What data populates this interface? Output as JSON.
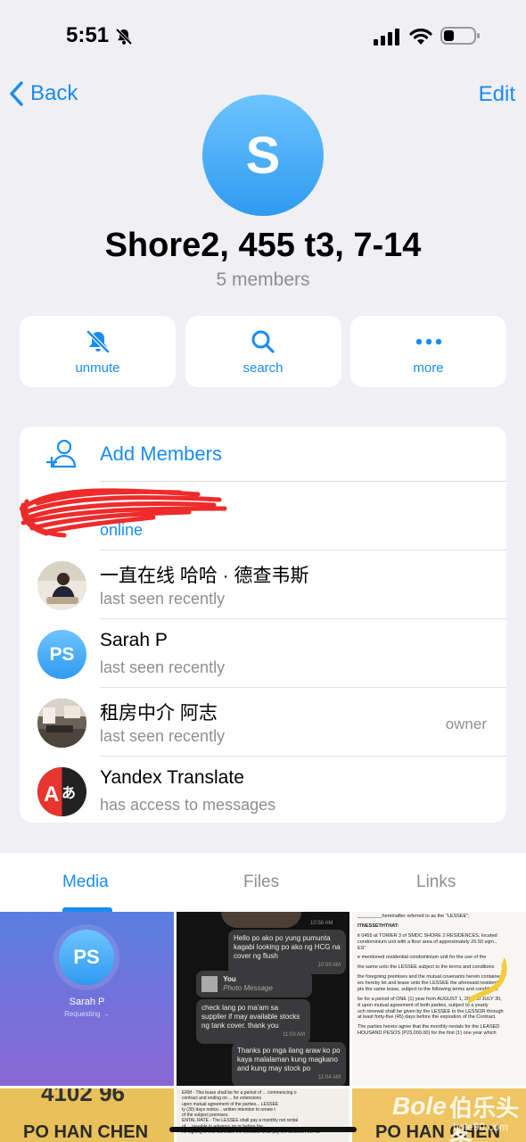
{
  "status_bar": {
    "time": "5:51"
  },
  "nav": {
    "back_label": "Back",
    "edit_label": "Edit"
  },
  "group": {
    "avatar_letter": "S",
    "title": "Shore2, 455 t3, 7-14",
    "subtitle": "5 members"
  },
  "actions": [
    {
      "label": "unmute",
      "icon": "bell-slash-icon"
    },
    {
      "label": "search",
      "icon": "magnifier-icon"
    },
    {
      "label": "more",
      "icon": "ellipsis-icon"
    }
  ],
  "members": {
    "add_label": "Add Members",
    "list": [
      {
        "name": "",
        "status": "online",
        "role": "",
        "avatar": "redacted"
      },
      {
        "name": "一直在线 哈哈 · 德查韦斯",
        "status": "last seen recently",
        "role": "",
        "avatar": "photo-person"
      },
      {
        "name": "Sarah P",
        "status": "last seen recently",
        "role": "",
        "avatar_initials": "PS"
      },
      {
        "name": "租房中介 阿志",
        "status": "last seen recently",
        "role": "owner",
        "avatar": "photo-room"
      },
      {
        "name": "Yandex Translate",
        "status": "has access to messages",
        "role": "",
        "avatar": "yandex-translate-icon"
      }
    ]
  },
  "tabs": [
    {
      "label": "Media",
      "active": true
    },
    {
      "label": "Files",
      "active": false
    },
    {
      "label": "Links",
      "active": false
    }
  ],
  "media": {
    "contact_card": {
      "initials": "PS",
      "name": "Sarah P",
      "subtitle": "Requesting →"
    },
    "chat": {
      "top_time": "10:58 AM",
      "messages": [
        {
          "text": "Hello po ako po yung pumunta kagabi looking po ako ng HCG na cover ng flush",
          "time": "10:59 AM"
        },
        {
          "sender": "You",
          "subtitle": "Photo Message"
        },
        {
          "text": "check lang po ma'am sa supplier if may available stocks ng tank cover. thank you",
          "time": "11:03 AM"
        },
        {
          "text": "Thanks po mga ilang araw ko po kaya malalaman kung magkano and kung may stock po",
          "time": "11:04 AM"
        }
      ]
    },
    "document": {
      "lines": [
        "_________hereinafter referred to as the \"LESSEE\";",
        "ITNESSETHTHAT:",
        "it 0455 at TOWER 3 of SMDC SHORE 2 RESIDENCES, located",
        "condominium unit with a floor area of approximately 26.50 sqm.,",
        "ES\"",
        "e mentioned residential condominium unit for the use of the",
        "the same unto the LESSEE subject to the terms and conditions",
        "the foregoing premises and the mutual covenants herein contained,",
        "ies hereby let and lease unto the LESSEE the aforesaid residential",
        "pts the same lease, subject to the following terms and conditions:",
        "be for a period of ONE (1) year from AUGUST 1, 2023 to JULY 30,",
        "d upon mutual agreement of both parties, subject to a yearly",
        "uch renewal shall be given by the LESSEE to the LESSOR through",
        "at least forty-five (45) days before the expiration of the Contract.",
        "The parties hereto agree that the monthly rentals for the LEASED",
        "HOUSAND PESOS (P23,000.00) for the first (1) one year which"
      ]
    },
    "bottom_row": {
      "left_text": "PO HAN CHEN",
      "left_number": "4102 96",
      "mid_lines": [
        "ERM - This lease shall be for a period of ... commencing o",
        "contract and ending on ... for extensions",
        "upon mutual agreement of the parties... LESSEE",
        "ty (30) days notice... written intention to renew t",
        "of the subject premises.",
        "ENTAL RATE - The LESSEE shall pay a monthly net rental",
        "of ... payable in advance on or before the",
        "he signing of this Contract, the LESSEE shall pay the LESSOR the su"
      ],
      "right_text": "PO HAN CHEN"
    }
  },
  "watermark": {
    "brand": "Bole",
    "cn": "伯乐头条",
    "url": "bole90.com"
  }
}
